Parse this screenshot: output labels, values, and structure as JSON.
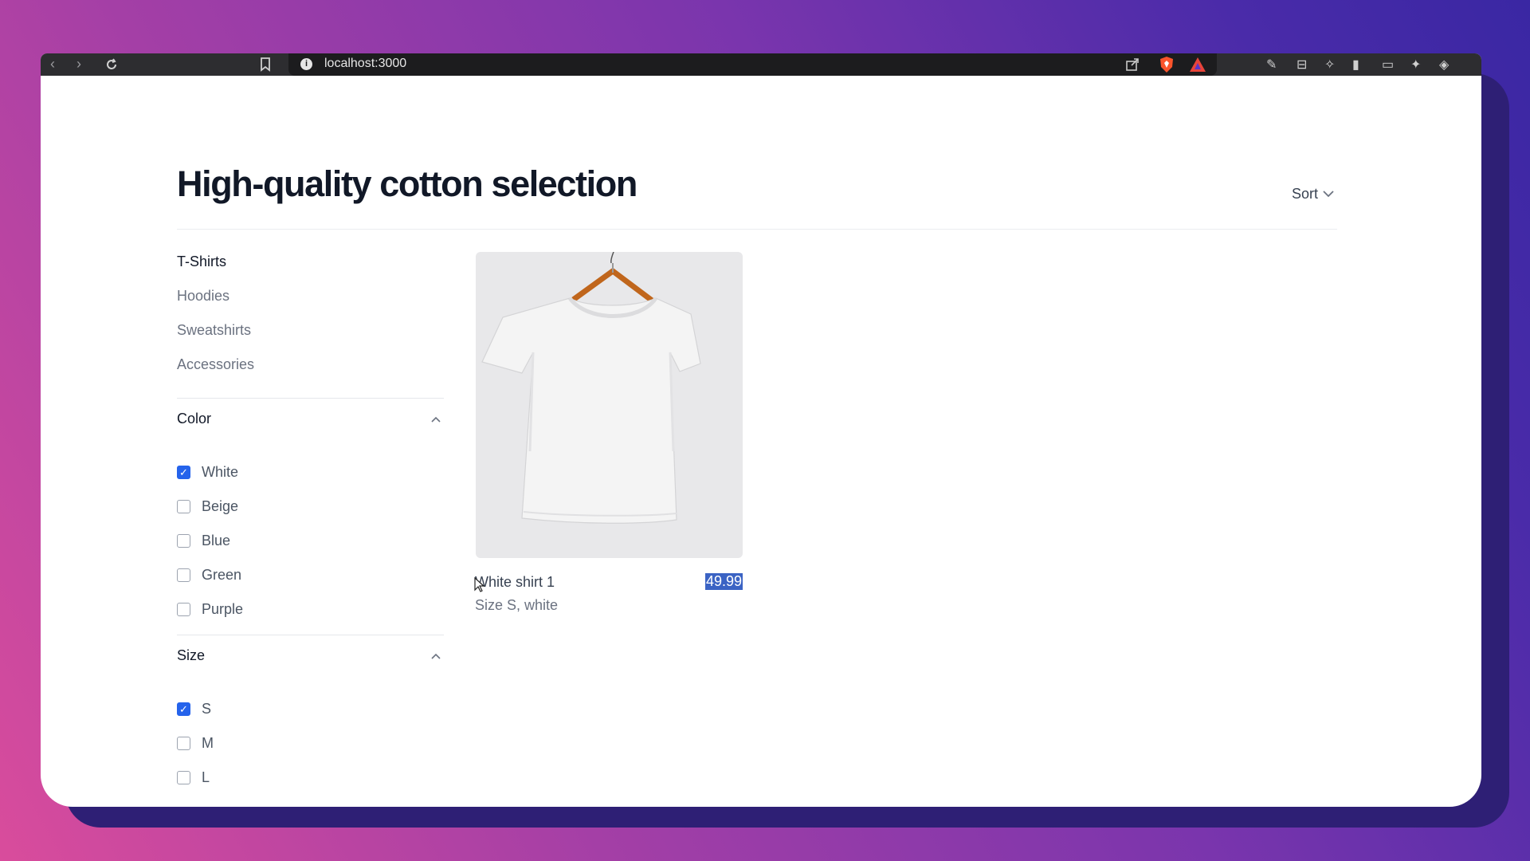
{
  "browser": {
    "url": "localhost:3000",
    "icons": [
      "back-icon",
      "forward-icon",
      "reload-icon",
      "bookmark-icon",
      "info-icon",
      "share-icon",
      "brave-shield-icon",
      "brave-rewards-icon",
      "pen-icon",
      "extension-icon",
      "puzzle-icon",
      "sidebar-icon",
      "wallet-icon",
      "sparkle-icon",
      "vpn-icon"
    ]
  },
  "header": {
    "title": "High-quality cotton selection",
    "sort_label": "Sort"
  },
  "categories": [
    {
      "label": "T-Shirts",
      "active": true
    },
    {
      "label": "Hoodies",
      "active": false
    },
    {
      "label": "Sweatshirts",
      "active": false
    },
    {
      "label": "Accessories",
      "active": false
    }
  ],
  "filters": {
    "color": {
      "label": "Color",
      "options": [
        {
          "label": "White",
          "checked": true
        },
        {
          "label": "Beige",
          "checked": false
        },
        {
          "label": "Blue",
          "checked": false
        },
        {
          "label": "Green",
          "checked": false
        },
        {
          "label": "Purple",
          "checked": false
        }
      ]
    },
    "size": {
      "label": "Size",
      "options": [
        {
          "label": "S",
          "checked": true
        },
        {
          "label": "M",
          "checked": false
        },
        {
          "label": "L",
          "checked": false
        }
      ]
    }
  },
  "products": [
    {
      "name": "White shirt 1",
      "price": "49.99",
      "meta": "Size S, white",
      "image": "white-tshirt-on-hanger"
    }
  ]
}
